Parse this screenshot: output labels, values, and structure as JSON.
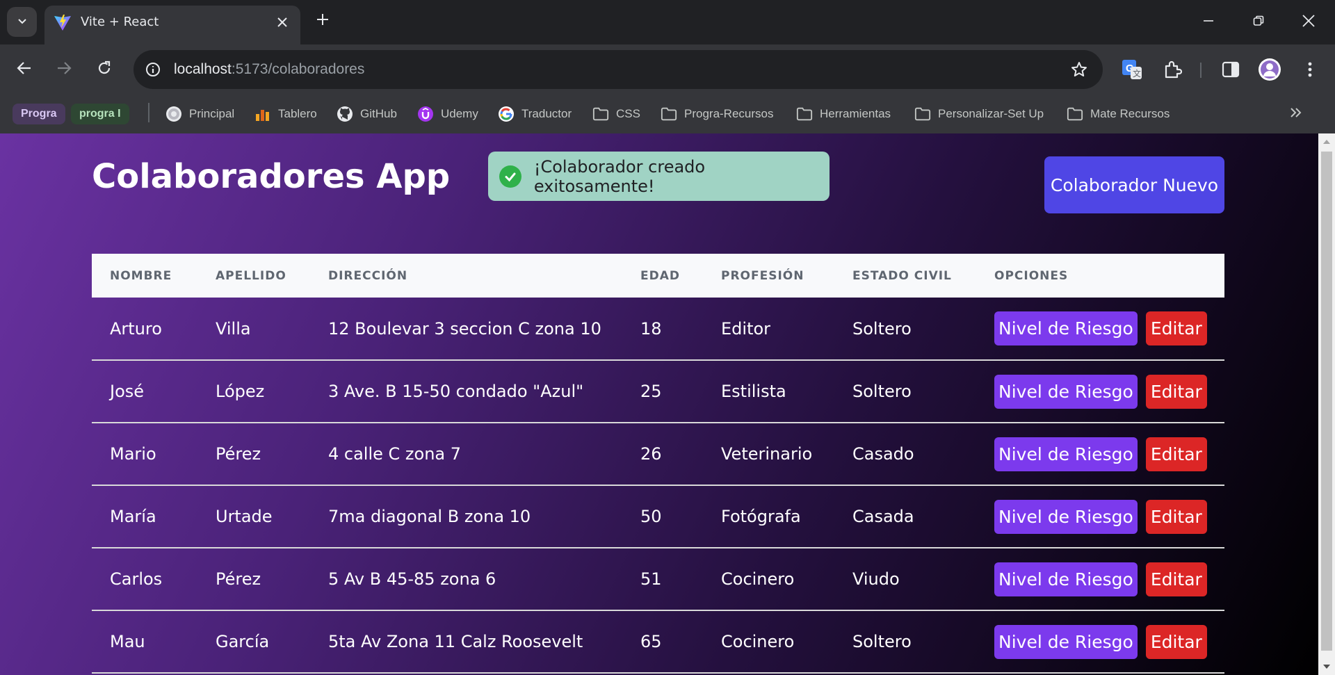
{
  "browser": {
    "tab_title": "Vite + React",
    "url_host": "localhost",
    "url_path": ":5173/colaboradores",
    "bookmark_chips": [
      "Progra",
      "progra I"
    ],
    "bookmarks": [
      {
        "label": "Principal",
        "icon": "principal-icon"
      },
      {
        "label": "Tablero",
        "icon": "tablero-icon"
      },
      {
        "label": "GitHub",
        "icon": "github-icon"
      },
      {
        "label": "Udemy",
        "icon": "udemy-icon"
      },
      {
        "label": "Traductor",
        "icon": "google-icon"
      },
      {
        "label": "CSS",
        "icon": "folder-icon"
      },
      {
        "label": "Progra-Recursos",
        "icon": "folder-icon"
      },
      {
        "label": "Herramientas",
        "icon": "folder-icon"
      },
      {
        "label": "Personalizar-Set Up",
        "icon": "folder-icon"
      },
      {
        "label": "Mate Recursos",
        "icon": "folder-icon"
      }
    ]
  },
  "app": {
    "title": "Colaboradores App",
    "toast_message": "¡Colaborador creado exitosamente!",
    "new_button": "Colaborador Nuevo"
  },
  "table": {
    "headers": [
      "NOMBRE",
      "APELLIDO",
      "DIRECCIÓN",
      "EDAD",
      "PROFESIÓN",
      "ESTADO CIVIL",
      "OPCIONES"
    ],
    "risk_label": "Nivel de Riesgo",
    "edit_label": "Editar",
    "rows": [
      {
        "nombre": "Arturo",
        "apellido": "Villa",
        "direccion": "12 Boulevar 3 seccion C zona 10",
        "edad": "18",
        "profesion": "Editor",
        "estado": "Soltero"
      },
      {
        "nombre": "José",
        "apellido": "López",
        "direccion": "3 Ave. B 15-50 condado \"Azul\"",
        "edad": "25",
        "profesion": "Estilista",
        "estado": "Soltero"
      },
      {
        "nombre": "Mario",
        "apellido": "Pérez",
        "direccion": "4 calle C zona 7",
        "edad": "26",
        "profesion": "Veterinario",
        "estado": "Casado"
      },
      {
        "nombre": "María",
        "apellido": "Urtade",
        "direccion": "7ma diagonal B zona 10",
        "edad": "50",
        "profesion": "Fotógrafa",
        "estado": "Casada"
      },
      {
        "nombre": "Carlos",
        "apellido": "Pérez",
        "direccion": "5 Av B 45-85 zona 6",
        "edad": "51",
        "profesion": "Cocinero",
        "estado": "Viudo"
      },
      {
        "nombre": "Mau",
        "apellido": "García",
        "direccion": "5ta Av Zona 11 Calz Roosevelt",
        "edad": "65",
        "profesion": "Cocinero",
        "estado": "Soltero"
      }
    ]
  },
  "colors": {
    "accent": "#4f46e5",
    "risk_button": "#7c3aed",
    "edit_button": "#dc2626",
    "toast_bg": "#a0d3c4",
    "toast_check": "#2fb14a"
  }
}
